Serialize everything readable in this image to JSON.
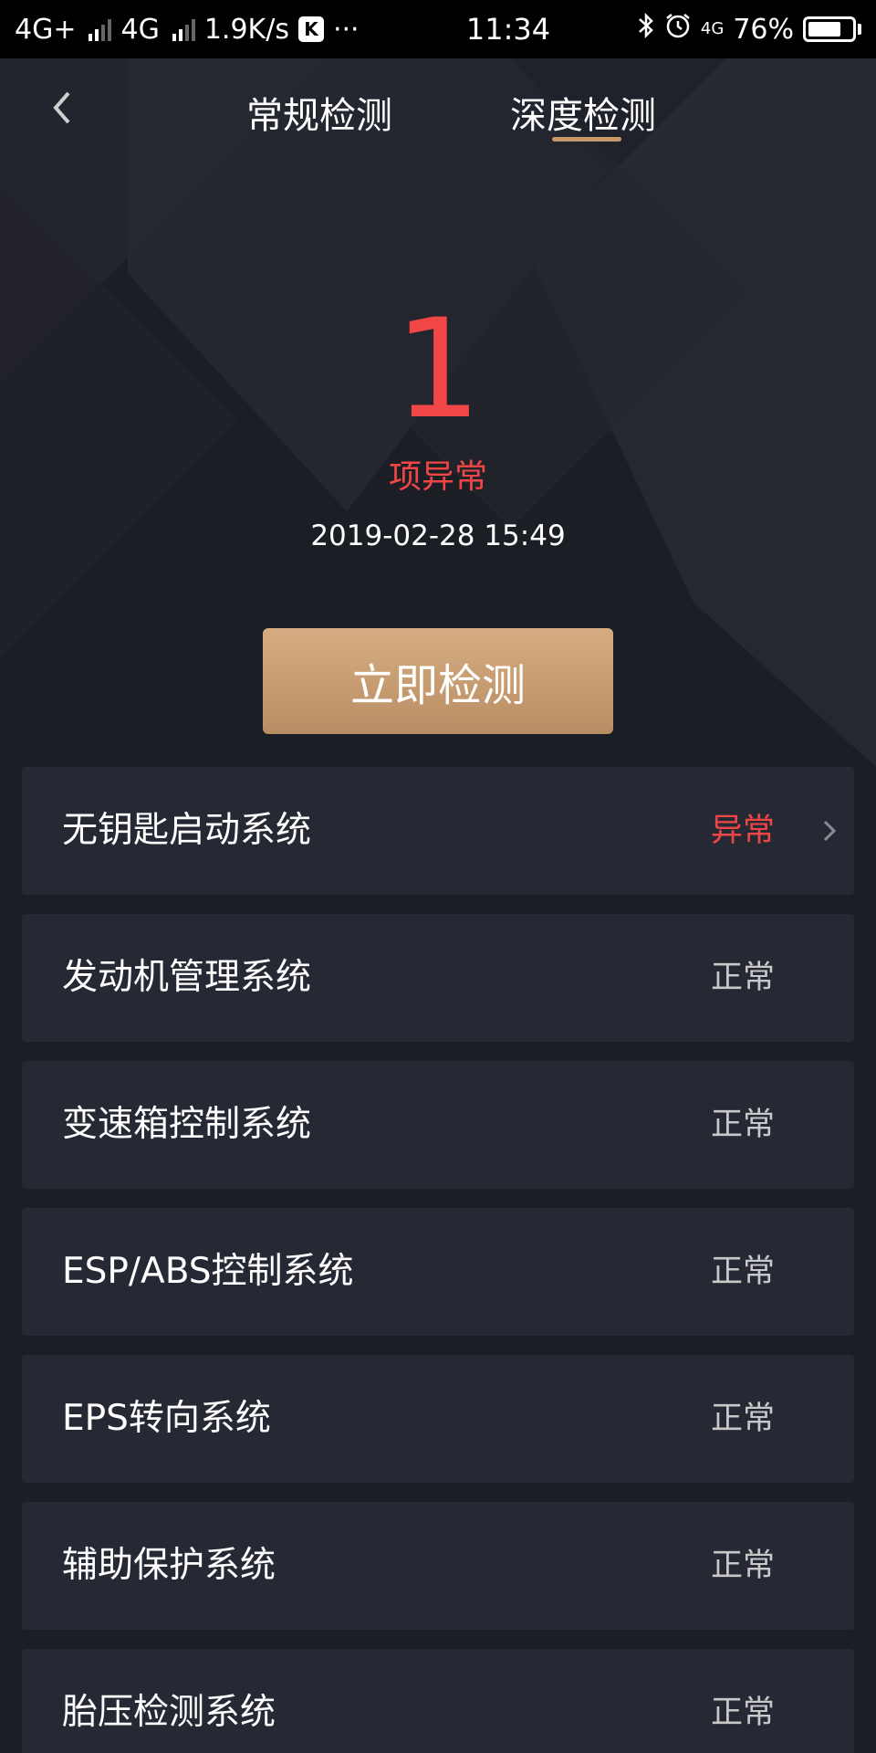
{
  "status_bar": {
    "network1": "4G+",
    "network2": "4G",
    "speed": "1.9K/s",
    "app_badge": "K",
    "more": "···",
    "time": "11:34",
    "data_type": "4G",
    "battery_text": "76%",
    "battery_level": 0.76
  },
  "header": {
    "tabs": [
      {
        "label": "常规检测",
        "active": false
      },
      {
        "label": "深度检测",
        "active": true
      }
    ]
  },
  "summary": {
    "count": "1",
    "count_label": "项异常",
    "timestamp": "2019-02-28 15:49"
  },
  "actions": {
    "detect_now": "立即检测"
  },
  "systems": [
    {
      "name": "无钥匙启动系统",
      "status": "异常",
      "abnormal": true
    },
    {
      "name": "发动机管理系统",
      "status": "正常",
      "abnormal": false
    },
    {
      "name": "变速箱控制系统",
      "status": "正常",
      "abnormal": false
    },
    {
      "name": "ESP/ABS控制系统",
      "status": "正常",
      "abnormal": false
    },
    {
      "name": "EPS转向系统",
      "status": "正常",
      "abnormal": false
    },
    {
      "name": "辅助保护系统",
      "status": "正常",
      "abnormal": false
    },
    {
      "name": "胎压检测系统",
      "status": "正常",
      "abnormal": false
    }
  ],
  "colors": {
    "background": "#1c1e25",
    "card": "#262934",
    "accent_gold": "#c9986a",
    "alert_red": "#f04646",
    "normal_gray": "#c8c8c8"
  }
}
